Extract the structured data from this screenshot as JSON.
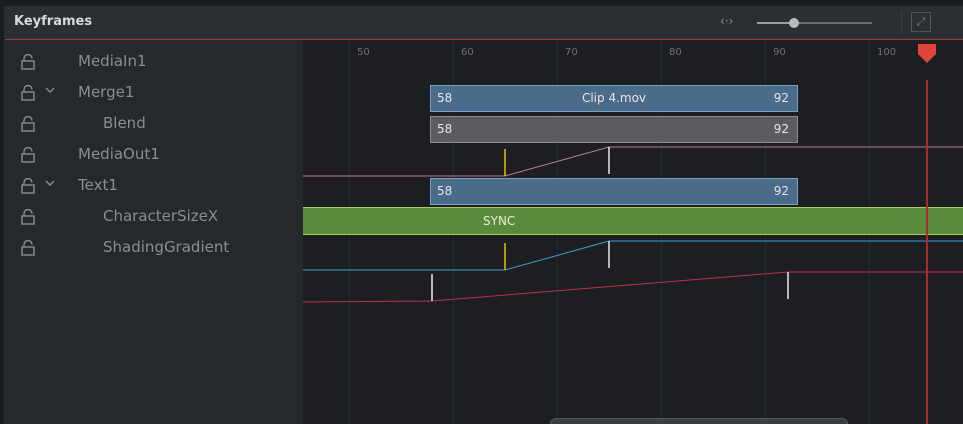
{
  "panel": {
    "title": "Keyframes",
    "zoom_icon": "fit-horizontal-icon",
    "zoom_level": 0.32,
    "expand_icon": "maximize-icon"
  },
  "tree": [
    {
      "name": "MediaIn1",
      "expandable": false
    },
    {
      "name": "Merge1",
      "expandable": true
    },
    {
      "name": "Blend",
      "expandable": false
    },
    {
      "name": "MediaOut1",
      "expandable": false
    },
    {
      "name": "Text1",
      "expandable": true
    },
    {
      "name": "CharacterSizeX",
      "expandable": false
    },
    {
      "name": "ShadingGradient",
      "expandable": false
    }
  ],
  "ruler": {
    "ticks": [
      "50",
      "60",
      "70",
      "80",
      "90",
      "100"
    ]
  },
  "clips": {
    "mediain": {
      "start": "58",
      "end": "92",
      "name": "Clip 4.mov"
    },
    "merge": {
      "start": "58",
      "end": "92"
    },
    "mediaout": {
      "start": "58",
      "end": "92"
    }
  },
  "sync_label": "SYNC",
  "playhead_frame": 105,
  "colors": {
    "header_border": "#a83a34",
    "clip_blue": "#4b6b8a",
    "sync_green": "#5a8a3c",
    "playhead": "#e0443c",
    "keyframe_yellow": "#e8c200",
    "curve_pink": "#c07a9a",
    "curve_blue": "#3aa0d8",
    "curve_red": "#c0304a"
  }
}
